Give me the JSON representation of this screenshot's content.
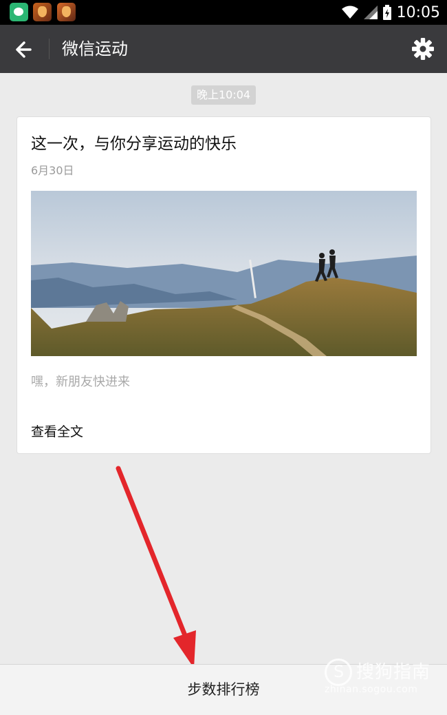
{
  "status_bar": {
    "time": "10:05",
    "icons": [
      "chat-app-icon",
      "game-app-icon",
      "game-app-icon",
      "wifi-icon",
      "signal-icon",
      "battery-icon"
    ]
  },
  "app_bar": {
    "title": "微信运动",
    "back_icon": "back-arrow-icon",
    "settings_icon": "gear-icon"
  },
  "conversation": {
    "time_label": "晚上10:04"
  },
  "article_card": {
    "title": "这一次，与你分享运动的快乐",
    "date": "6月30日",
    "image_description": "hikers-on-mountain-ridge",
    "desc": "嘿，新朋友快进来",
    "read_more": "查看全文"
  },
  "bottom_bar": {
    "rank_label": "步数排行榜"
  },
  "overlay": {
    "arrow_color": "#e3262b",
    "watermark_brand": "搜狗指南",
    "watermark_url": "zhinan.sogou.com"
  },
  "colors": {
    "app_bar_bg": "#3a3a3d",
    "page_bg": "#ebebeb",
    "time_chip_bg": "#d3d3d3"
  }
}
